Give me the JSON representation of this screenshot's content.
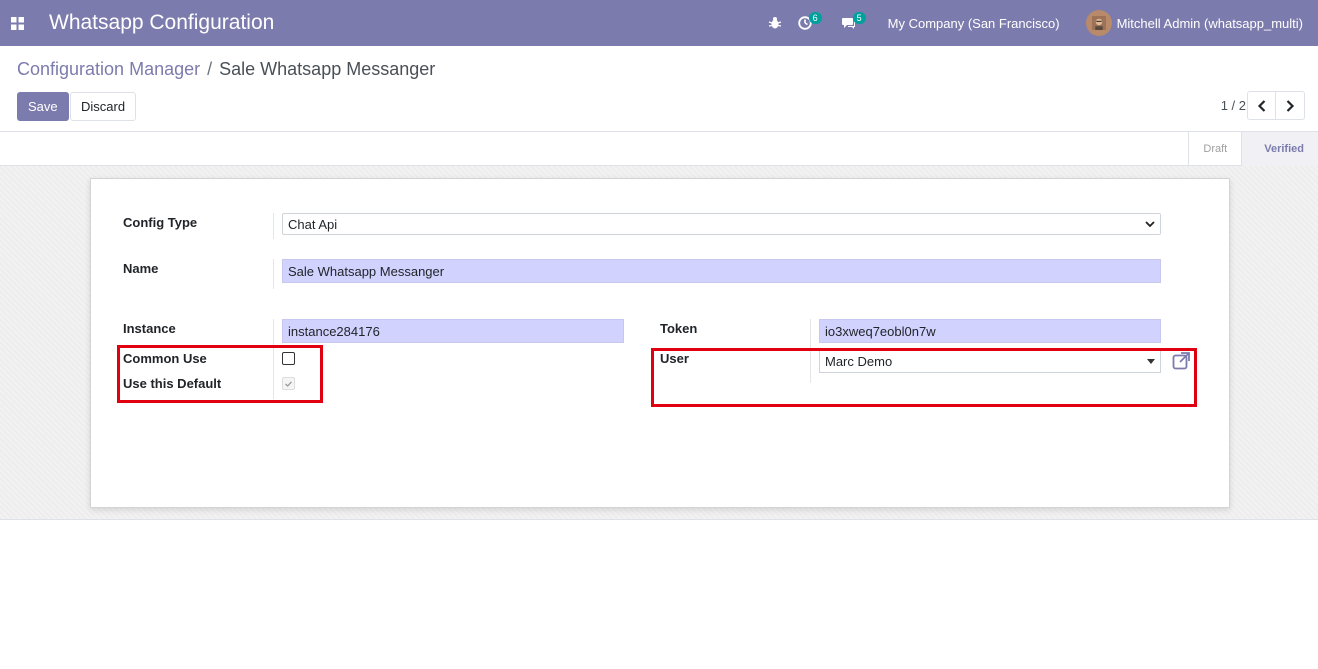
{
  "navbar": {
    "title": "Whatsapp Configuration",
    "activity_count": "6",
    "message_count": "5",
    "company": "My Company (San Francisco)",
    "user": "Mitchell Admin (whatsapp_multi)"
  },
  "breadcrumb": {
    "parent": "Configuration Manager",
    "separator": "/",
    "current": "Sale Whatsapp Messanger"
  },
  "buttons": {
    "save": "Save",
    "discard": "Discard"
  },
  "pager": {
    "value": "1 / 2"
  },
  "status": {
    "stages": [
      "Draft",
      "Verified"
    ],
    "active": "Verified"
  },
  "form": {
    "config_type_label": "Config Type",
    "config_type_value": "Chat Api",
    "name_label": "Name",
    "name_value": "Sale Whatsapp Messanger",
    "instance_label": "Instance",
    "instance_value": "instance284176",
    "token_label": "Token",
    "token_value": "io3xweq7eobl0n7w",
    "common_use_label": "Common Use",
    "common_use_checked": false,
    "use_default_label": "Use this Default",
    "use_default_checked": true,
    "user_label": "User",
    "user_value": "Marc Demo"
  },
  "colors": {
    "brand": "#7c7bad",
    "highlight": "#e0000f",
    "required_field": "#d2d2ff"
  }
}
